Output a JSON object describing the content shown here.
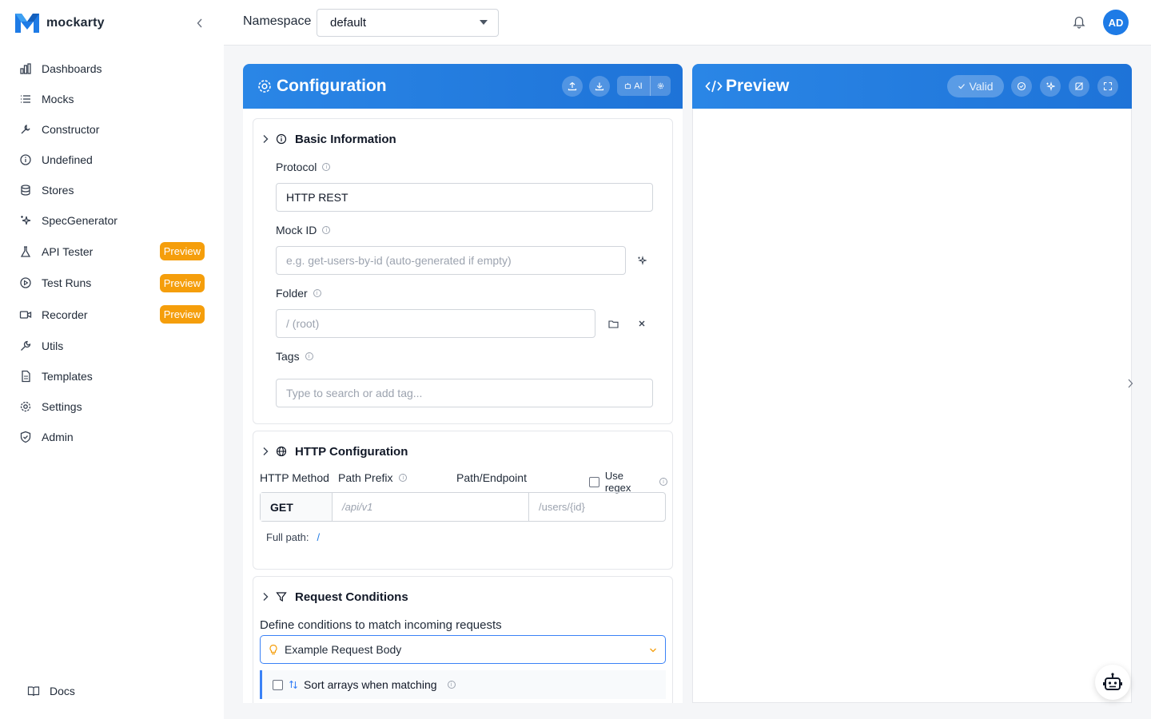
{
  "app": {
    "name": "mockarty"
  },
  "sidebar": {
    "items": [
      {
        "label": "Dashboards",
        "icon": "bar-chart-icon"
      },
      {
        "label": "Mocks",
        "icon": "list-icon"
      },
      {
        "label": "Constructor",
        "icon": "wrench-icon"
      },
      {
        "label": "Undefined",
        "icon": "info-circle-icon"
      },
      {
        "label": "Stores",
        "icon": "database-icon"
      },
      {
        "label": "SpecGenerator",
        "icon": "sparkles-icon"
      },
      {
        "label": "API Tester",
        "icon": "flask-icon",
        "badge": "Preview"
      },
      {
        "label": "Test Runs",
        "icon": "play-circle-icon",
        "badge": "Preview"
      },
      {
        "label": "Recorder",
        "icon": "video-icon",
        "badge": "Preview"
      },
      {
        "label": "Utils",
        "icon": "tool-icon"
      },
      {
        "label": "Templates",
        "icon": "file-icon"
      },
      {
        "label": "Settings",
        "icon": "gear-icon"
      },
      {
        "label": "Admin",
        "icon": "shield-icon"
      }
    ],
    "docs_label": "Docs"
  },
  "header": {
    "namespace_label": "Namespace",
    "namespace_value": "default",
    "avatar_initials": "AD"
  },
  "config": {
    "title": "Configuration",
    "ai_label": "AI",
    "basic": {
      "title": "Basic Information",
      "protocol_label": "Protocol",
      "protocol_value": "HTTP REST",
      "mock_id_label": "Mock ID",
      "mock_id_placeholder": "e.g. get-users-by-id (auto-generated if empty)",
      "folder_label": "Folder",
      "folder_placeholder": "/ (root)",
      "tags_label": "Tags",
      "tags_placeholder": "Type to search or add tag..."
    },
    "http": {
      "title": "HTTP Configuration",
      "method_label": "HTTP Method",
      "prefix_label": "Path Prefix",
      "path_label": "Path/Endpoint",
      "regex_label": "Use regex",
      "method_value": "GET",
      "prefix_placeholder": "/api/v1",
      "path_placeholder": "/users/{id}",
      "full_path_label": "Full path:",
      "full_path_value": "/"
    },
    "conditions": {
      "title": "Request Conditions",
      "description": "Define conditions to match incoming requests",
      "example_label": "Example Request Body",
      "sort_label": "Sort arrays when matching"
    }
  },
  "preview": {
    "title": "Preview",
    "valid_label": "Valid"
  },
  "colors": {
    "accent": "#1e7be6",
    "badge": "#f59e0b"
  }
}
